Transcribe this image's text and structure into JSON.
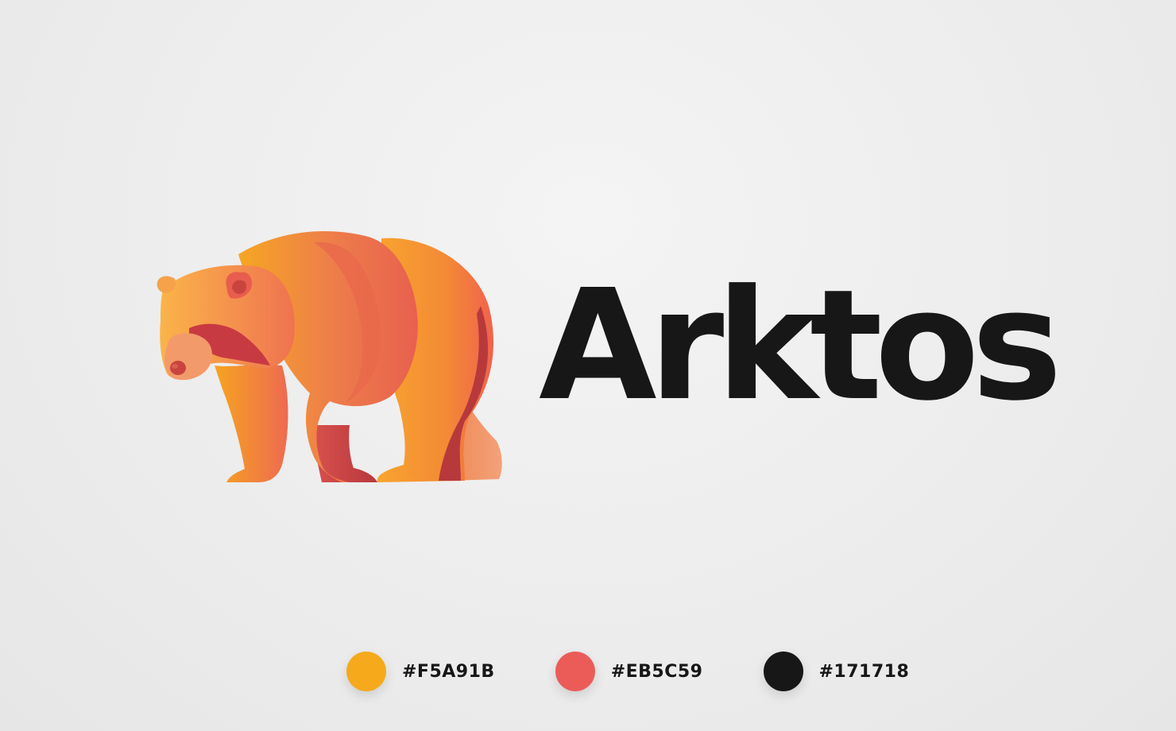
{
  "brand": {
    "name": "Arktos",
    "logo_icon": "bear-icon"
  },
  "palette": [
    {
      "hex": "#F5A91B",
      "label": "#F5A91B"
    },
    {
      "hex": "#EB5C59",
      "label": "#EB5C59"
    },
    {
      "hex": "#171718",
      "label": "#171718"
    }
  ]
}
